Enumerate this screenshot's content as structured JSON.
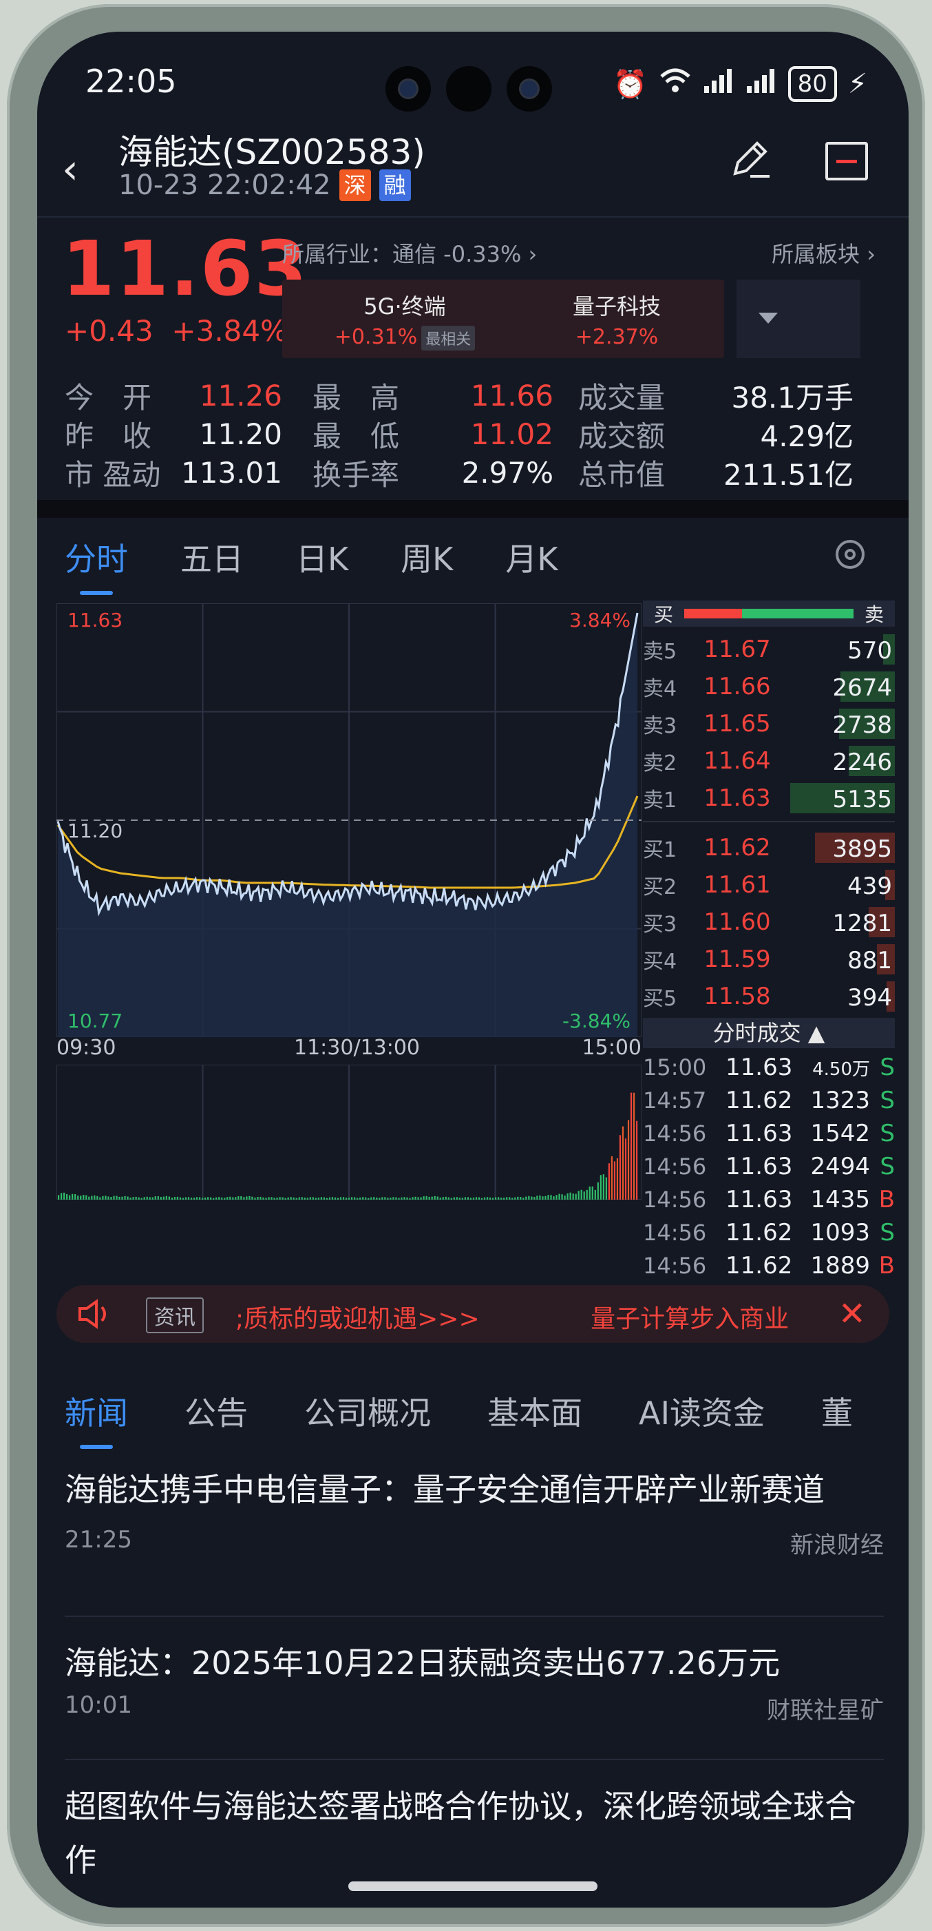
{
  "status": {
    "time": "22:05",
    "battery": "80"
  },
  "header": {
    "title": "海能达(SZ002583)",
    "datetime": "10-23 22:02:42",
    "tag_market": "深",
    "tag_margin": "融"
  },
  "quote": {
    "price": "11.63",
    "change": "+0.43",
    "change_pct": "+3.84%",
    "industry": "所属行业：通信 -0.33% ›",
    "sector_link": "所属板块 ›",
    "sectors": [
      {
        "name": "5G·终端",
        "value": "+0.31%",
        "label": "最相关"
      },
      {
        "name": "量子科技",
        "value": "+2.37%",
        "label": ""
      }
    ]
  },
  "stats": [
    {
      "l1": "今　开",
      "v1": "11.26",
      "l2": "最　高",
      "v2": "11.66",
      "l3": "成交量",
      "v3": "38.1万手"
    },
    {
      "l1": "昨　收",
      "v1": "11.20",
      "l2": "最　低",
      "v2": "11.02",
      "l3": "成交额",
      "v3": "4.29亿"
    },
    {
      "l1": "市 盈动",
      "v1": "113.01",
      "l2": "换手率",
      "v2": "2.97%",
      "l3": "总市值",
      "v3": "211.51亿"
    }
  ],
  "chart_tabs": [
    "分时",
    "五日",
    "日K",
    "周K",
    "月K"
  ],
  "chart_data": {
    "type": "line",
    "title": "",
    "x_labels": [
      "09:30",
      "11:30/13:00",
      "15:00"
    ],
    "ylim": [
      10.77,
      11.63
    ],
    "y_top_label": "11.63",
    "y_mid_label": "11.20",
    "y_bottom_label": "10.77",
    "pct_top_label": "3.84%",
    "pct_bottom_label": "-3.84%",
    "reference": 11.2,
    "series": [
      {
        "values": [
          11.19,
          11.08,
          11.02,
          11.04,
          11.03,
          11.05,
          11.06,
          11.07,
          11.06,
          11.05,
          11.05,
          11.06,
          11.05,
          11.04,
          11.05,
          11.06,
          11.05,
          11.05,
          11.04,
          11.04,
          11.03,
          11.03,
          11.04,
          11.06,
          11.1,
          11.14,
          11.22,
          11.4,
          11.63
        ]
      },
      {
        "values": [
          11.19,
          11.13,
          11.1,
          11.09,
          11.085,
          11.08,
          11.08,
          11.075,
          11.075,
          11.07,
          11.07,
          11.07,
          11.068,
          11.066,
          11.065,
          11.064,
          11.063,
          11.062,
          11.06,
          11.06,
          11.06,
          11.06,
          11.06,
          11.062,
          11.065,
          11.07,
          11.08,
          11.15,
          11.25
        ]
      }
    ],
    "volume": [
      6,
      4,
      3,
      3,
      2,
      3,
      2,
      2,
      2,
      3,
      2,
      2,
      2,
      2,
      2,
      2,
      2,
      2,
      3,
      2,
      2,
      2,
      2,
      3,
      4,
      6,
      12,
      40,
      100
    ]
  },
  "order_book": {
    "buy_label": "买",
    "sell_label": "卖",
    "asks": [
      {
        "label": "卖5",
        "price": "11.67",
        "qty": "570",
        "w": 0.11
      },
      {
        "label": "卖4",
        "price": "11.66",
        "qty": "2674",
        "w": 0.52
      },
      {
        "label": "卖3",
        "price": "11.65",
        "qty": "2738",
        "w": 0.53
      },
      {
        "label": "卖2",
        "price": "11.64",
        "qty": "2246",
        "w": 0.44
      },
      {
        "label": "卖1",
        "price": "11.63",
        "qty": "5135",
        "w": 1.0
      }
    ],
    "bids": [
      {
        "label": "买1",
        "price": "11.62",
        "qty": "3895",
        "w": 0.76
      },
      {
        "label": "买2",
        "price": "11.61",
        "qty": "439",
        "w": 0.09
      },
      {
        "label": "买3",
        "price": "11.60",
        "qty": "1281",
        "w": 0.25
      },
      {
        "label": "买4",
        "price": "11.59",
        "qty": "881",
        "w": 0.17
      },
      {
        "label": "买5",
        "price": "11.58",
        "qty": "394",
        "w": 0.08
      }
    ],
    "trades_title": "分时成交 ▲",
    "trades": [
      {
        "t": "15:00",
        "p": "11.63",
        "q": "4.50万",
        "s": "S"
      },
      {
        "t": "14:57",
        "p": "11.62",
        "q": "1323",
        "s": "S"
      },
      {
        "t": "14:56",
        "p": "11.63",
        "q": "1542",
        "s": "S"
      },
      {
        "t": "14:56",
        "p": "11.63",
        "q": "2494",
        "s": "S"
      },
      {
        "t": "14:56",
        "p": "11.63",
        "q": "1435",
        "s": "B"
      },
      {
        "t": "14:56",
        "p": "11.62",
        "q": "1093",
        "s": "S"
      },
      {
        "t": "14:56",
        "p": "11.62",
        "q": "1889",
        "s": "B"
      }
    ]
  },
  "ticker": {
    "badge": "资讯",
    "text": ";质标的或迎机遇>>>",
    "text2": "量子计算步入商业"
  },
  "news_tabs": [
    "新闻",
    "公告",
    "公司概况",
    "基本面",
    "AI读资金",
    "董"
  ],
  "news": [
    {
      "headline": "海能达携手中电信量子：量子安全通信开辟产业新赛道",
      "time": "21:25",
      "source": "新浪财经"
    },
    {
      "headline": "海能达：2025年10月22日获融资卖出677.26万元",
      "time": "10:01",
      "source": "财联社星矿"
    },
    {
      "headline": "超图软件与海能达签署战略合作协议，深化跨领域全球合作",
      "time": "",
      "source": ""
    }
  ],
  "colors": {
    "up": "#f4433c",
    "down": "#2fbf6a",
    "accent": "#3d8ef5",
    "price_line": "#c8dcf5",
    "avg_line": "#e6b422"
  }
}
